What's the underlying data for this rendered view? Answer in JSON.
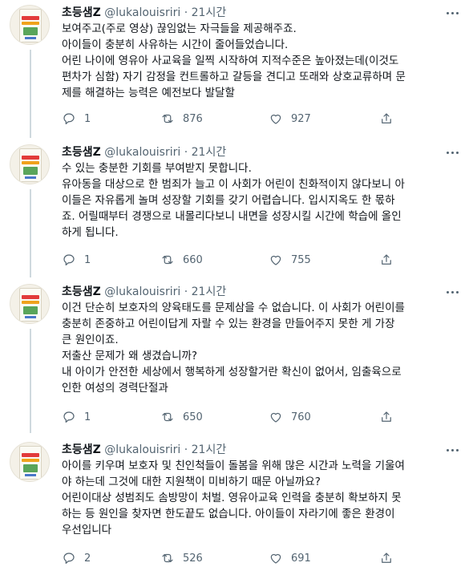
{
  "tweets": [
    {
      "name": "초등샘Z",
      "handle": "@lukalouisriri",
      "dot": "·",
      "time": "21시간",
      "lines": [
        "보여주고(주로 영상) 끊임없는 자극들을 제공해주죠.",
        "아이들이 충분히 사유하는 시간이 줄어들었습니다.",
        "어린 나이에 영유아 사교육을 일찍 시작하여 지적수준은 높아졌는데(이것도",
        "편차가 심함) 자기 감정을 컨트롤하고 갈등을 견디고 또래와 상호교류하며 문",
        "제를 해결하는 능력은 예전보다 발달할"
      ],
      "replies": "1",
      "retweets": "876",
      "likes": "927"
    },
    {
      "name": "초등샘Z",
      "handle": "@lukalouisriri",
      "dot": "·",
      "time": "21시간",
      "lines": [
        "수 있는 충분한 기회를 부여받지 못합니다.",
        "유아동을 대상으로 한 범죄가 늘고 이 사회가 어린이 친화적이지 않다보니 아",
        "이들은 자유롭게 놀며 성장할 기회를 갖기 어렵습니다. 입시지옥도 한 몫하",
        "죠. 어릴때부터 경쟁으로 내몰리다보니 내면을 성장시킬 시간에 학습에 올인",
        "하게 됩니다."
      ],
      "replies": "1",
      "retweets": "660",
      "likes": "755"
    },
    {
      "name": "초등샘Z",
      "handle": "@lukalouisriri",
      "dot": "·",
      "time": "21시간",
      "lines": [
        "이건 단순히 보호자의 양육태도를 문제삼을 수 없습니다. 이 사회가 어린이를",
        "충분히 존중하고 어린이답게 자랄 수 있는 환경을 만들어주지 못한 게 가장",
        "큰 원인이죠.",
        "저출산 문제가 왜 생겼습니까?",
        "내 아이가 안전한 세상에서 행복하게 성장할거란 확신이 없어서, 임출육으로",
        "인한 여성의 경력단절과"
      ],
      "replies": "1",
      "retweets": "650",
      "likes": "760"
    },
    {
      "name": "초등샘Z",
      "handle": "@lukalouisriri",
      "dot": "·",
      "time": "21시간",
      "lines": [
        "아이를 키우며 보호자 및 친인척들이 돌봄을 위해 많은 시간과 노력을 기울여",
        "야 하는데 그것에 대한 지원책이 미비하기 때문 아닐까요?",
        "어린이대상 성범죄도 솜방망이 처벌. 영유아교육 인력을 충분히 확보하지 못",
        "하는 등 원인을 찾자면 한도끝도 없습니다. 아이들이 자라기에 좋은 환경이",
        "우선입니다"
      ],
      "replies": "2",
      "retweets": "526",
      "likes": "691"
    }
  ]
}
